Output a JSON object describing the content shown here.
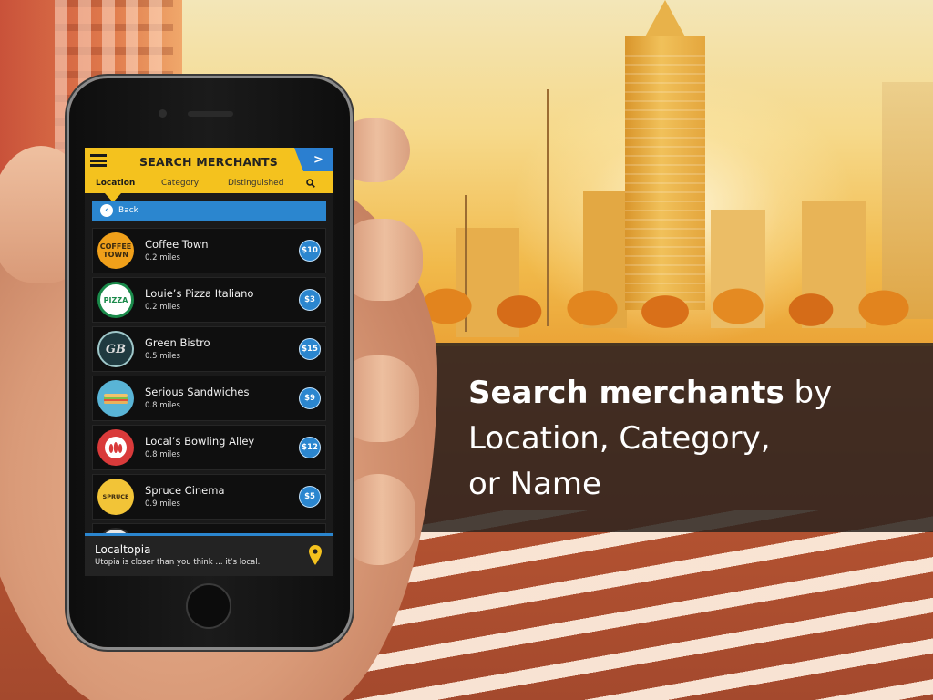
{
  "caption": {
    "line1_strong": "Search merchants",
    "line1_rest": " by",
    "line2": "Location, Category,",
    "line3": "or Name"
  },
  "app": {
    "title": "SEARCH MERCHANTS",
    "next_label": ">",
    "tabs": [
      "Location",
      "Category",
      "Distinguished"
    ],
    "active_tab": "Location",
    "back_label": "Back"
  },
  "merchants": [
    {
      "name": "Coffee Town",
      "distance": "0.2 miles",
      "price": "$10",
      "logo_text": "COFFEE TOWN",
      "logo_color": "#f0a01a",
      "logo_text_color": "#3a2a10",
      "icon": "coffee-town-logo"
    },
    {
      "name": "Louie’s Pizza Italiano",
      "distance": "0.2 miles",
      "price": "$3",
      "logo_text": "PIZZA",
      "logo_color": "#ffffff",
      "logo_text_color": "#1a8a4a",
      "icon": "pizza-logo"
    },
    {
      "name": "Green Bistro",
      "distance": "0.5 miles",
      "price": "$15",
      "logo_text": "GB",
      "logo_color": "#1f3a40",
      "logo_text_color": "#e0e0e0",
      "icon": "green-bistro-logo"
    },
    {
      "name": "Serious Sandwiches",
      "distance": "0.8 miles",
      "price": "$9",
      "logo_text": "",
      "logo_color": "#59b4d6",
      "logo_text_color": "#ffffff",
      "icon": "sandwich-logo"
    },
    {
      "name": "Local’s Bowling Alley",
      "distance": "0.8 miles",
      "price": "$12",
      "logo_text": "",
      "logo_color": "#d93a3a",
      "logo_text_color": "#ffffff",
      "icon": "bowling-logo"
    },
    {
      "name": "Spruce Cinema",
      "distance": "0.9 miles",
      "price": "$5",
      "logo_text": "SPRUCE",
      "logo_color": "#f2c437",
      "logo_text_color": "#3a2a10",
      "icon": "cinema-logo"
    }
  ],
  "footer": {
    "title": "Localtopia",
    "tagline": "Utopia is closer than you think ... it’s local."
  },
  "colors": {
    "header_yellow": "#f4c21e",
    "accent_blue": "#2b86cf"
  }
}
